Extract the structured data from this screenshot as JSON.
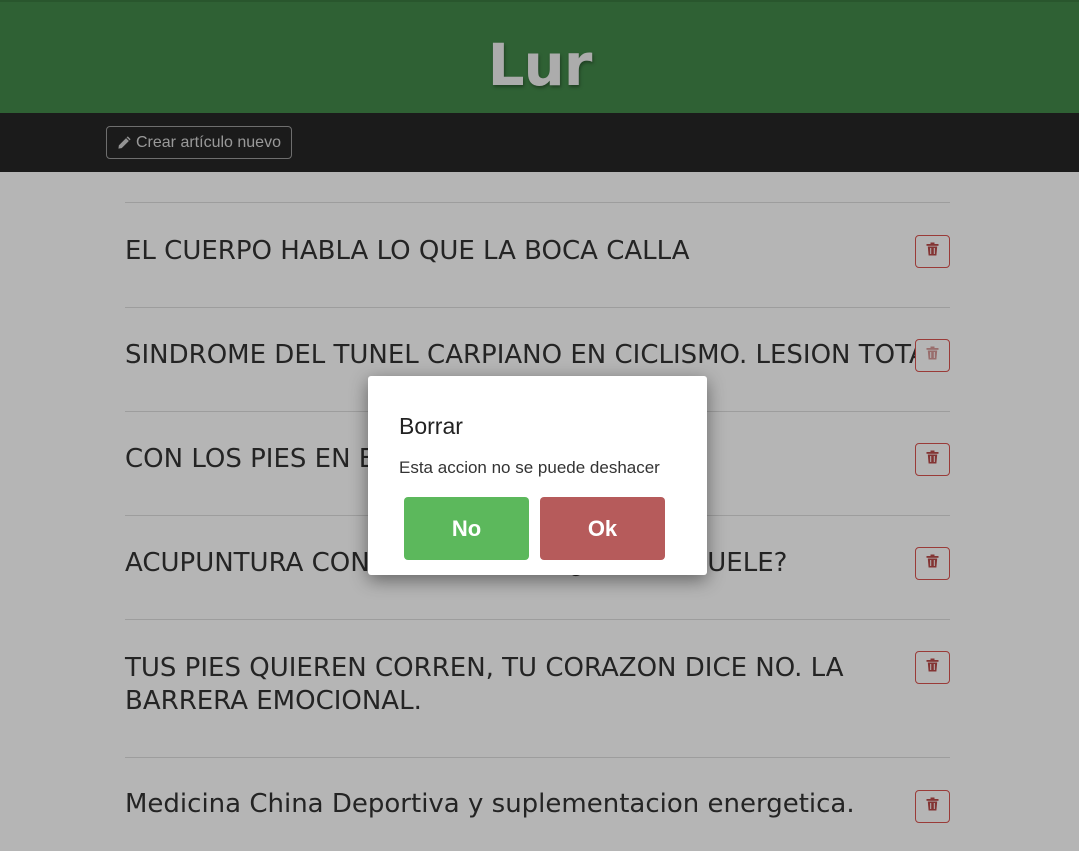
{
  "header": {
    "brand": "Lur"
  },
  "toolbar": {
    "create_label": "Crear artículo nuevo",
    "icon": "pencil-icon"
  },
  "articles": [
    {
      "title": "EL CUERPO HABLA LO QUE LA BOCA CALLA"
    },
    {
      "title": "SINDROME DEL TUNEL CARPIANO EN CICLISMO. LESION TOTAL"
    },
    {
      "title": "CON LOS PIES EN EL SUELO"
    },
    {
      "title": "ACUPUNTURA CONTRA EL DOLOR ¿QUE TE DUELE?"
    },
    {
      "title": "TUS PIES QUIEREN CORREN, TU CORAZON DICE NO. LA BARRERA EMOCIONAL."
    },
    {
      "title": "Medicina China Deportiva y suplementacion energetica."
    }
  ],
  "dialog": {
    "title": "Borrar",
    "message": "Esta accion no se puede deshacer",
    "no_label": "No",
    "ok_label": "Ok"
  },
  "colors": {
    "header_green": "#43894a",
    "toolbar_dark": "#262626",
    "danger": "#d9534f",
    "success": "#5cb85c"
  }
}
